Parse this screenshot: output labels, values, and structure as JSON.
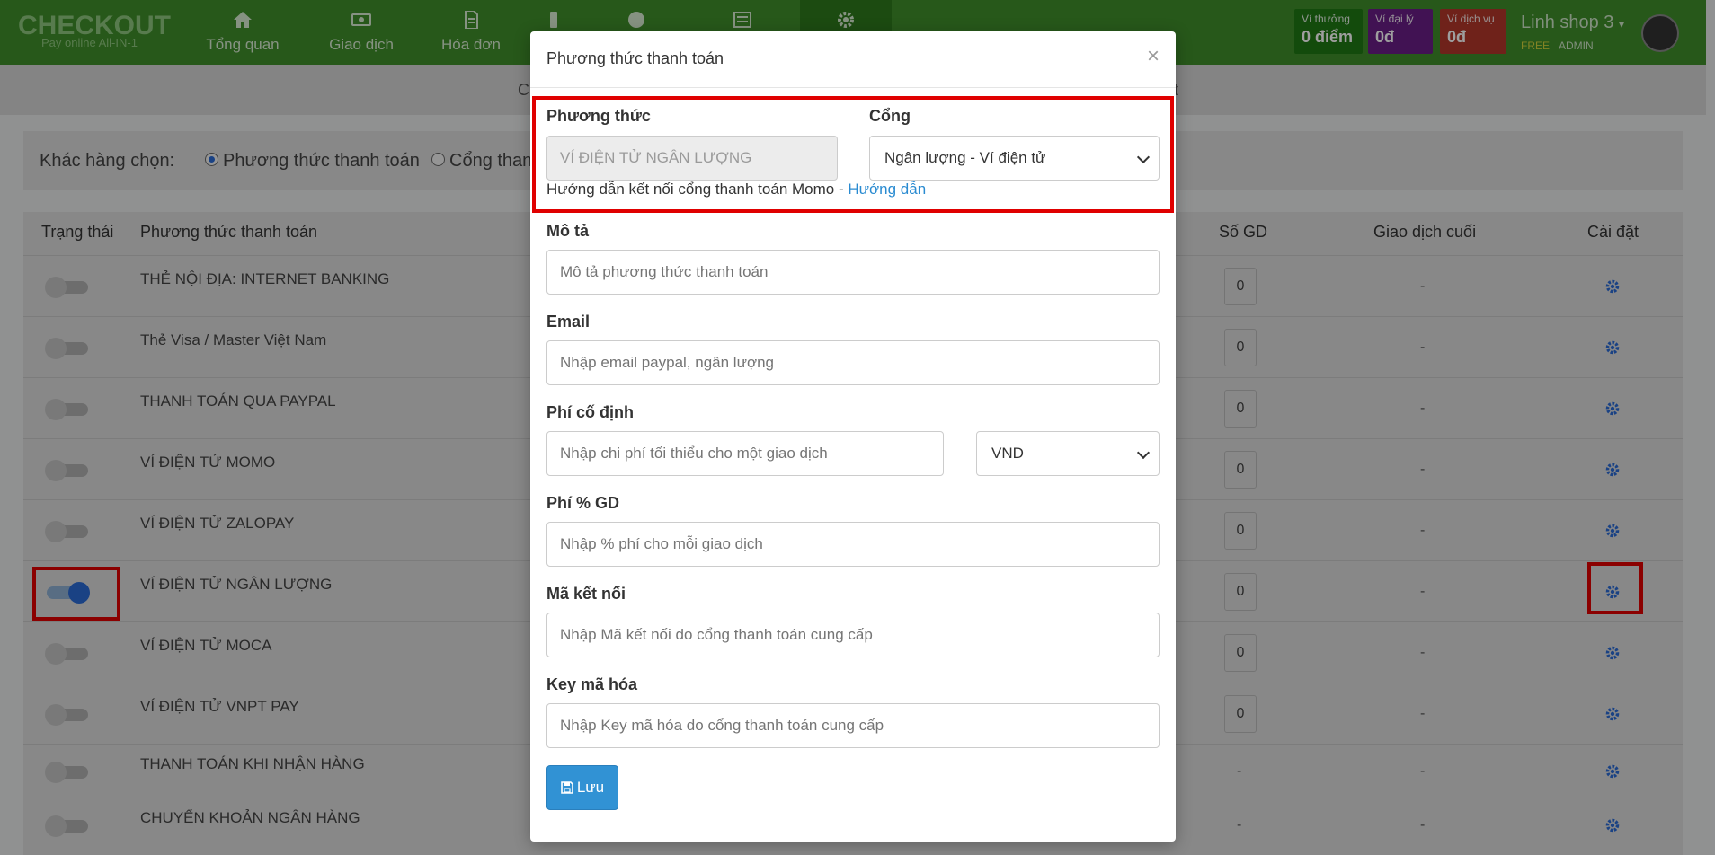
{
  "header": {
    "logo_main": "CHECKOUT",
    "logo_sub": "Pay online All-IN-1",
    "nav": [
      {
        "label": "Tổng quan",
        "icon": "home-icon"
      },
      {
        "label": "Giao dịch",
        "icon": "money-icon"
      },
      {
        "label": "Hóa đơn",
        "icon": "invoice-icon"
      },
      {
        "label": "",
        "icon": "mobile-icon"
      },
      {
        "label": "",
        "icon": "globe-icon"
      },
      {
        "label": "",
        "icon": "newspaper-icon"
      },
      {
        "label": "",
        "icon": "gear-icon"
      }
    ],
    "wallets": [
      {
        "title": "Ví thưởng",
        "value": "0 điểm",
        "color": "#1f7a14"
      },
      {
        "title": "Ví đại lý",
        "value": "0đ",
        "color": "#6a1d86"
      },
      {
        "title": "Ví dịch vụ",
        "value": "0đ",
        "color": "#b3372a"
      }
    ],
    "shop_name": "Linh shop 3",
    "plan": "FREE",
    "role": "ADMIN"
  },
  "subbar": {
    "left_text": "C",
    "right_text": "t"
  },
  "choice": {
    "label": "Khác hàng chọn:",
    "options": [
      "Phương thức thanh toán",
      "Cổng than"
    ]
  },
  "table": {
    "headers": {
      "status": "Trạng thái",
      "method": "Phương thức thanh toán",
      "count": "Số GD",
      "last": "Giao dịch cuối",
      "settings": "Cài đặt"
    },
    "rows": [
      {
        "name": "THẺ NỘI ĐỊA: INTERNET BANKING",
        "enabled": false,
        "count": "0",
        "last": "-"
      },
      {
        "name": "Thẻ Visa / Master Việt Nam",
        "enabled": false,
        "count": "0",
        "last": "-"
      },
      {
        "name": "THANH TOÁN QUA PAYPAL",
        "enabled": false,
        "count": "0",
        "last": "-"
      },
      {
        "name": "VÍ ĐIỆN TỬ MOMO",
        "enabled": false,
        "count": "0",
        "last": "-"
      },
      {
        "name": "VÍ ĐIỆN TỬ ZALOPAY",
        "enabled": false,
        "count": "0",
        "last": "-"
      },
      {
        "name": "VÍ ĐIỆN TỬ NGÂN LƯỢNG",
        "enabled": true,
        "count": "0",
        "last": "-"
      },
      {
        "name": "VÍ ĐIỆN TỬ MOCA",
        "enabled": false,
        "count": "0",
        "last": "-"
      },
      {
        "name": "VÍ ĐIỆN TỬ VNPT PAY",
        "enabled": false,
        "count": "0",
        "last": "-"
      },
      {
        "name": "THANH TOÁN KHI NHẬN HÀNG",
        "enabled": false,
        "count": "-",
        "last": "-"
      },
      {
        "name": "CHUYỂN KHOẢN NGÂN HÀNG",
        "enabled": false,
        "count": "-",
        "last": "-"
      }
    ]
  },
  "modal": {
    "title": "Phương thức thanh toán",
    "close": "×",
    "method_label": "Phương thức",
    "method_value": "VÍ ĐIỆN TỬ NGÂN LƯỢNG",
    "gateway_label": "Cổng",
    "gateway_value": "Ngân lượng - Ví điện tử",
    "hint_text": "Hướng dẫn kết nối cổng thanh toán Momo - ",
    "hint_link": "Hướng dẫn",
    "desc_label": "Mô tả",
    "desc_placeholder": "Mô tả phương thức thanh toán",
    "email_label": "Email",
    "email_placeholder": "Nhập email paypal, ngân lượng",
    "fixed_fee_label": "Phí cố định",
    "fixed_fee_placeholder": "Nhập chi phí tối thiểu cho một giao dịch",
    "currency_value": "VND",
    "pct_fee_label": "Phí % GD",
    "pct_fee_placeholder": "Nhập % phí cho mỗi giao dịch",
    "conn_label": "Mã kết nối",
    "conn_placeholder": "Nhập Mã kết nối do cổng thanh toán cung cấp",
    "key_label": "Key mã hóa",
    "key_placeholder": "Nhập Key mã hóa do cổng thanh toán cung cấp",
    "save_label": "Lưu"
  }
}
